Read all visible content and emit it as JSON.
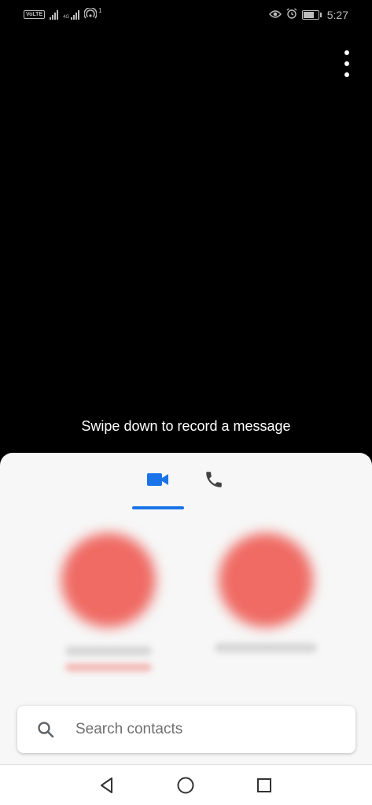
{
  "status_bar": {
    "volte_label": "VoLTE",
    "network_1": "4G",
    "hotspot_count": "1",
    "time": "5:27"
  },
  "main": {
    "swipe_hint": "Swipe down to record a message"
  },
  "tabs": [
    {
      "name": "video",
      "icon": "video-camera-icon",
      "selected": true,
      "color": "#1a73e8"
    },
    {
      "name": "voice",
      "icon": "phone-icon",
      "selected": false,
      "color": "#424242"
    }
  ],
  "search": {
    "placeholder": "Search contacts"
  },
  "colors": {
    "accent": "#1a73e8",
    "avatar": "#ef6b64"
  }
}
